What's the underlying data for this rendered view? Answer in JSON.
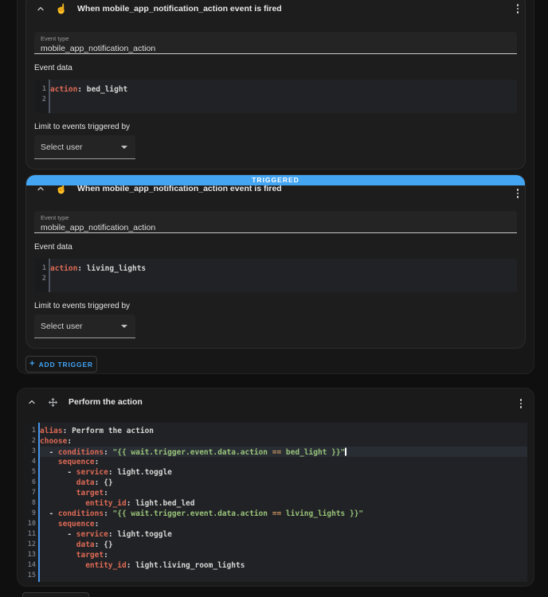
{
  "colors": {
    "accent_blue": "#44a5f3",
    "add_button_blue": "#40a3f4",
    "code_key": "#de6a56",
    "code_string": "#98c379",
    "code_operator": "#d19a66",
    "code_text": "#d6d6d6",
    "editor_active_gutter": "#4795e8"
  },
  "triggers_section": {
    "triggers": [
      {
        "title": "When mobile_app_notification_action event is fired",
        "event_type": {
          "label": "Event type",
          "value": "mobile_app_notification_action"
        },
        "event_data_label": "Event data",
        "limit_label": "Limit to events triggered by",
        "user_select": {
          "value": "Select user"
        }
      },
      {
        "badge": "TRIGGERED",
        "title": "When mobile_app_notification_action event is fired",
        "event_type": {
          "label": "Event type",
          "value": "mobile_app_notification_action"
        },
        "event_data_label": "Event data",
        "limit_label": "Limit to events triggered by",
        "user_select": {
          "value": "Select user"
        }
      }
    ],
    "add_trigger": {
      "plus": "+",
      "label": "ADD TRIGGER"
    }
  },
  "action_section": {
    "title": "Perform the action"
  },
  "editors": {
    "trigger0": {
      "lines": [
        [
          {
            "c": "key",
            "t": "action"
          },
          {
            "c": "pl",
            "t": ": "
          },
          {
            "c": "val",
            "t": "bed_light"
          }
        ],
        []
      ]
    },
    "trigger1": {
      "lines": [
        [
          {
            "c": "key",
            "t": "action"
          },
          {
            "c": "pl",
            "t": ": "
          },
          {
            "c": "val",
            "t": "living_lights"
          }
        ],
        []
      ]
    },
    "action": {
      "active_line": 3,
      "cursor_line": 3,
      "lines": [
        [
          {
            "c": "key",
            "t": "alias"
          },
          {
            "c": "pl",
            "t": ": "
          },
          {
            "c": "val",
            "t": "Perform the action"
          }
        ],
        [
          {
            "c": "key",
            "t": "choose"
          },
          {
            "c": "pl",
            "t": ":"
          }
        ],
        [
          {
            "c": "pl",
            "t": "  - "
          },
          {
            "c": "key",
            "t": "conditions"
          },
          {
            "c": "pl",
            "t": ": "
          },
          {
            "c": "str",
            "t": "\"{{ wait.trigger.event.data.action "
          },
          {
            "c": "op",
            "t": "=="
          },
          {
            "c": "str",
            "t": " bed_light }}\""
          }
        ],
        [
          {
            "c": "pl",
            "t": "    "
          },
          {
            "c": "key",
            "t": "sequence"
          },
          {
            "c": "pl",
            "t": ":"
          }
        ],
        [
          {
            "c": "pl",
            "t": "      - "
          },
          {
            "c": "key",
            "t": "service"
          },
          {
            "c": "pl",
            "t": ": "
          },
          {
            "c": "val",
            "t": "light.toggle"
          }
        ],
        [
          {
            "c": "pl",
            "t": "        "
          },
          {
            "c": "key",
            "t": "data"
          },
          {
            "c": "pl",
            "t": ": "
          },
          {
            "c": "val",
            "t": "{}"
          }
        ],
        [
          {
            "c": "pl",
            "t": "        "
          },
          {
            "c": "key",
            "t": "target"
          },
          {
            "c": "pl",
            "t": ":"
          }
        ],
        [
          {
            "c": "pl",
            "t": "          "
          },
          {
            "c": "key",
            "t": "entity_id"
          },
          {
            "c": "pl",
            "t": ": "
          },
          {
            "c": "val",
            "t": "light.bed_led"
          }
        ],
        [
          {
            "c": "pl",
            "t": "  - "
          },
          {
            "c": "key",
            "t": "conditions"
          },
          {
            "c": "pl",
            "t": ": "
          },
          {
            "c": "str",
            "t": "\"{{ wait.trigger.event.data.action "
          },
          {
            "c": "op",
            "t": "=="
          },
          {
            "c": "str",
            "t": " living_lights }}\""
          }
        ],
        [
          {
            "c": "pl",
            "t": "    "
          },
          {
            "c": "key",
            "t": "sequence"
          },
          {
            "c": "pl",
            "t": ":"
          }
        ],
        [
          {
            "c": "pl",
            "t": "      - "
          },
          {
            "c": "key",
            "t": "service"
          },
          {
            "c": "pl",
            "t": ": "
          },
          {
            "c": "val",
            "t": "light.toggle"
          }
        ],
        [
          {
            "c": "pl",
            "t": "        "
          },
          {
            "c": "key",
            "t": "data"
          },
          {
            "c": "pl",
            "t": ": "
          },
          {
            "c": "val",
            "t": "{}"
          }
        ],
        [
          {
            "c": "pl",
            "t": "        "
          },
          {
            "c": "key",
            "t": "target"
          },
          {
            "c": "pl",
            "t": ":"
          }
        ],
        [
          {
            "c": "pl",
            "t": "          "
          },
          {
            "c": "key",
            "t": "entity_id"
          },
          {
            "c": "pl",
            "t": ": "
          },
          {
            "c": "val",
            "t": "light.living_room_lights"
          }
        ],
        []
      ]
    }
  }
}
